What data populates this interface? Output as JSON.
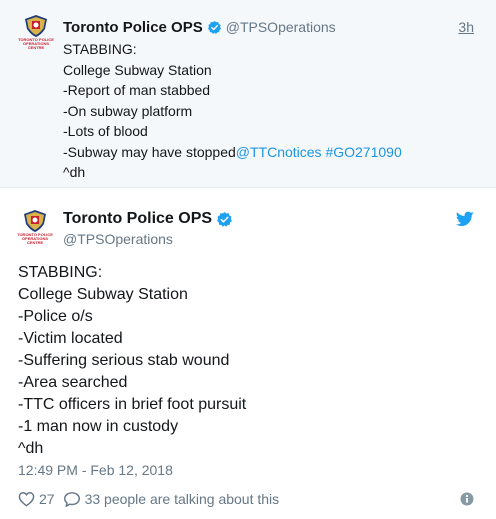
{
  "parent": {
    "name": "Toronto Police OPS",
    "handle": "@TPSOperations",
    "time": "3h",
    "avatar_text": [
      "TORONTO POLICE",
      "OPERATIONS",
      "CENTRE"
    ],
    "lines": [
      "STABBING:",
      "College Subway Station",
      "-Report of man stabbed",
      "-On subway platform",
      "-Lots of blood"
    ],
    "last_line_text": "-Subway may have stopped",
    "mention": "@TTCnotices",
    "hashtag": "#GO271090",
    "signature": "^dh"
  },
  "main": {
    "name": "Toronto Police OPS",
    "handle": "@TPSOperations",
    "avatar_text": [
      "TORONTO POLICE",
      "OPERATIONS",
      "CENTRE"
    ],
    "lines": [
      "STABBING:",
      "College Subway Station",
      "-Police o/s",
      "-Victim located",
      "-Suffering serious stab wound",
      "-Area searched",
      "-TTC officers in brief foot pursuit",
      "-1 man now in custody",
      "^dh"
    ],
    "timestamp": "12:49 PM - Feb 12, 2018",
    "likes": "27",
    "talking": "33 people are talking about this"
  },
  "colors": {
    "link": "#1b95e0",
    "verified": "#1da1f2",
    "muted": "#657786",
    "police_red": "#c8202f"
  },
  "icons": [
    "police-crest-icon",
    "verified-badge-icon",
    "twitter-bird-icon",
    "heart-icon",
    "comment-bubble-icon",
    "info-icon"
  ]
}
